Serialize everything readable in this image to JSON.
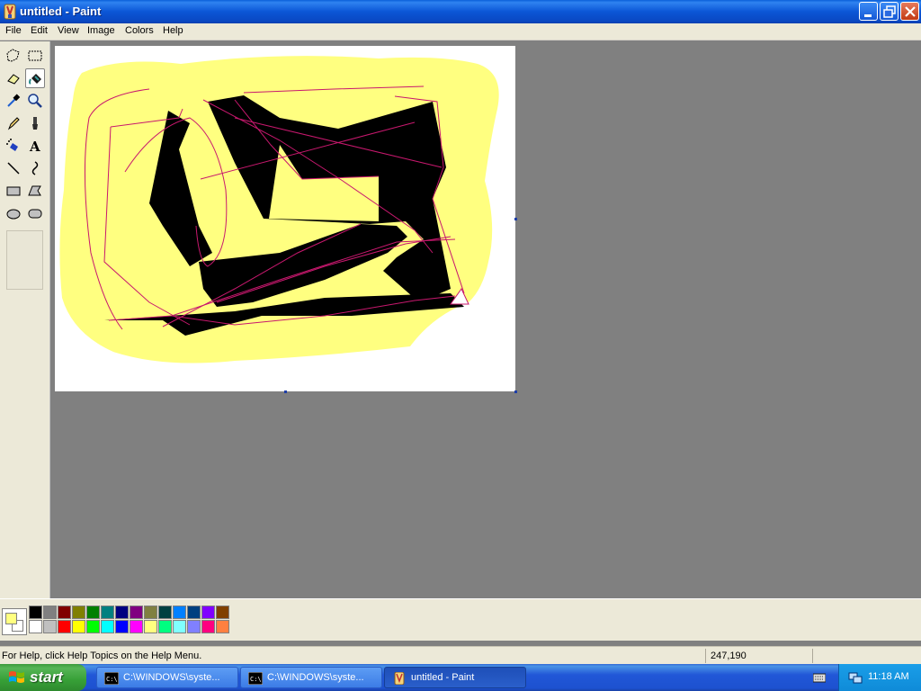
{
  "window": {
    "title": "untitled - Paint"
  },
  "menu": [
    "File",
    "Edit",
    "View",
    "Image",
    "Colors",
    "Help"
  ],
  "tools": [
    {
      "name": "free-form-select",
      "icon": "free-form-select-icon",
      "active": false
    },
    {
      "name": "select",
      "icon": "rect-select-icon",
      "active": false
    },
    {
      "name": "eraser",
      "icon": "eraser-icon",
      "active": false
    },
    {
      "name": "fill-with-color",
      "icon": "paint-bucket-icon",
      "active": true
    },
    {
      "name": "pick-color",
      "icon": "eyedropper-icon",
      "active": false
    },
    {
      "name": "magnifier",
      "icon": "magnifier-icon",
      "active": false
    },
    {
      "name": "pencil",
      "icon": "pencil-icon",
      "active": false
    },
    {
      "name": "brush",
      "icon": "brush-icon",
      "active": false
    },
    {
      "name": "airbrush",
      "icon": "airbrush-icon",
      "active": false
    },
    {
      "name": "text",
      "icon": "text-icon",
      "active": false
    },
    {
      "name": "line",
      "icon": "line-icon",
      "active": false
    },
    {
      "name": "curve",
      "icon": "curve-icon",
      "active": false
    },
    {
      "name": "rectangle",
      "icon": "rectangle-icon",
      "active": false
    },
    {
      "name": "polygon",
      "icon": "polygon-icon",
      "active": false
    },
    {
      "name": "ellipse",
      "icon": "ellipse-icon",
      "active": false
    },
    {
      "name": "rounded-rectangle",
      "icon": "rounded-rectangle-icon",
      "active": false
    }
  ],
  "colors": {
    "foreground": "#ffff80",
    "background": "#ffffff",
    "palette_top": [
      "#000000",
      "#808080",
      "#800000",
      "#808000",
      "#008000",
      "#008080",
      "#000080",
      "#800080",
      "#808040",
      "#004040",
      "#0080ff",
      "#004080",
      "#8000ff",
      "#804000"
    ],
    "palette_bottom": [
      "#ffffff",
      "#c0c0c0",
      "#ff0000",
      "#ffff00",
      "#00ff00",
      "#00ffff",
      "#0000ff",
      "#ff00ff",
      "#ffff80",
      "#00ff80",
      "#80ffff",
      "#8080ff",
      "#ff0080",
      "#ff8040"
    ]
  },
  "drawing": {
    "fill_yellow": "#ffff80",
    "shape_black": "#000000",
    "line_color": "#c8186e"
  },
  "status": {
    "help": "For Help, click Help Topics on the Help Menu.",
    "coords": "247,190"
  },
  "taskbar": {
    "start_label": "start",
    "tasks": [
      {
        "label": "C:\\WINDOWS\\syste...",
        "icon": "cmd-icon"
      },
      {
        "label": "C:\\WINDOWS\\syste...",
        "icon": "cmd-icon"
      },
      {
        "label": "untitled - Paint",
        "icon": "paint-icon"
      }
    ],
    "clock": "11:18 AM"
  }
}
